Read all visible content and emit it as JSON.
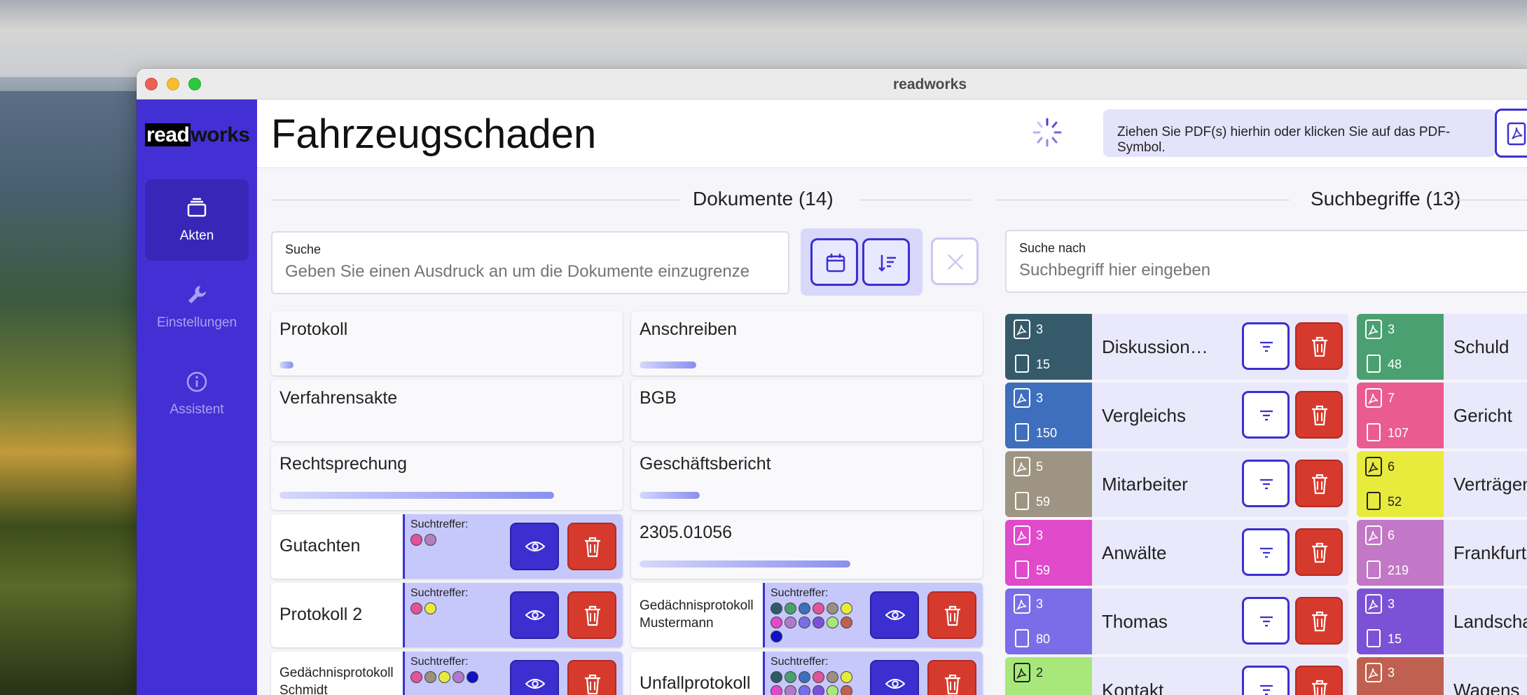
{
  "window": {
    "title": "readworks"
  },
  "sidebar": {
    "logo_a": "read",
    "logo_b": "works",
    "items": [
      {
        "label": "Akten",
        "icon": "stack-icon",
        "active": true
      },
      {
        "label": "Einstellungen",
        "icon": "wrench-icon",
        "active": false
      },
      {
        "label": "Assistent",
        "icon": "info-icon",
        "active": false
      }
    ]
  },
  "header": {
    "title": "Fahrzeugschaden",
    "dropzone_text": "Ziehen Sie PDF(s) hierhin oder klicken Sie auf das PDF-Symbol."
  },
  "documents": {
    "section_title": "Dokumente (14)",
    "search_label": "Suche",
    "search_placeholder": "Geben Sie einen Ausdruck an um die Dokumente einzugrenzen",
    "cards": [
      {
        "name": "Protokoll",
        "progress": 0.04
      },
      {
        "name": "Anschreiben",
        "progress": 0.17
      },
      {
        "name": "Verfahrensakte",
        "progress": null
      },
      {
        "name": "BGB",
        "progress": null
      },
      {
        "name": "Rechtsprechung",
        "progress": 0.82
      },
      {
        "name": "Geschäftsbericht",
        "progress": 0.18
      },
      {
        "name": "2305.01056",
        "progress": 0.63
      }
    ],
    "hit_label": "Suchtreffer:",
    "hits": [
      {
        "name": "Gutachten",
        "dots": [
          "#e0559a",
          "#b57fbf"
        ]
      },
      {
        "name": "Protokoll 2",
        "dots": [
          "#e0559a",
          "#e8ea3c"
        ]
      },
      {
        "name": "Gedächnisprotokoll Mustermann",
        "dots": [
          "#2e5a6a",
          "#4aa070",
          "#3e6fbd",
          "#e0559a",
          "#9a9080",
          "#e8ea3c",
          "#e04acb",
          "#b07acb",
          "#7a6ee8",
          "#7b52d6",
          "#a8e87a",
          "#c06050",
          "#1010c8"
        ]
      },
      {
        "name": "Gedächnisprotokoll Schmidt",
        "dots": [
          "#e0559a",
          "#9a9080",
          "#e8ea3c",
          "#b07acb",
          "#1010c8"
        ]
      },
      {
        "name": "Unfallprotokoll",
        "dots": [
          "#2e5a6a",
          "#4aa070",
          "#3e6fbd",
          "#e0559a",
          "#9a9080",
          "#e8ea3c",
          "#e04acb",
          "#b07acb",
          "#7a6ee8",
          "#7b52d6",
          "#a8e87a",
          "#c06050"
        ]
      }
    ]
  },
  "terms": {
    "section_title": "Suchbegriffe (13)",
    "search_label": "Suche nach",
    "search_placeholder": "Suchbegriff hier eingeben",
    "items": [
      {
        "name": "Diskussion…",
        "pdfs": "3",
        "pages": "15",
        "color": "#355b6b"
      },
      {
        "name": "Vergleichs",
        "pdfs": "3",
        "pages": "150",
        "color": "#3e6fbd"
      },
      {
        "name": "Mitarbeiter",
        "pdfs": "5",
        "pages": "59",
        "color": "#9e9483"
      },
      {
        "name": "Anwälte",
        "pdfs": "3",
        "pages": "59",
        "color": "#e04acb"
      },
      {
        "name": "Thomas",
        "pdfs": "3",
        "pages": "80",
        "color": "#7a6ee8"
      },
      {
        "name": "Kontakt",
        "pdfs": "2",
        "pages": "",
        "color": "#a8e87a"
      },
      {
        "name": "Schuld",
        "pdfs": "3",
        "pages": "48",
        "color": "#4aa070"
      },
      {
        "name": "Gericht",
        "pdfs": "7",
        "pages": "107",
        "color": "#ea5b90"
      },
      {
        "name": "Verträgen",
        "pdfs": "6",
        "pages": "52",
        "color": "#e8ea3c"
      },
      {
        "name": "Frankfurt",
        "pdfs": "6",
        "pages": "219",
        "color": "#c278c6"
      },
      {
        "name": "Landscha",
        "pdfs": "3",
        "pages": "15",
        "color": "#7b52d6"
      },
      {
        "name": "Wagens",
        "pdfs": "3",
        "pages": "",
        "color": "#c06050"
      }
    ]
  }
}
